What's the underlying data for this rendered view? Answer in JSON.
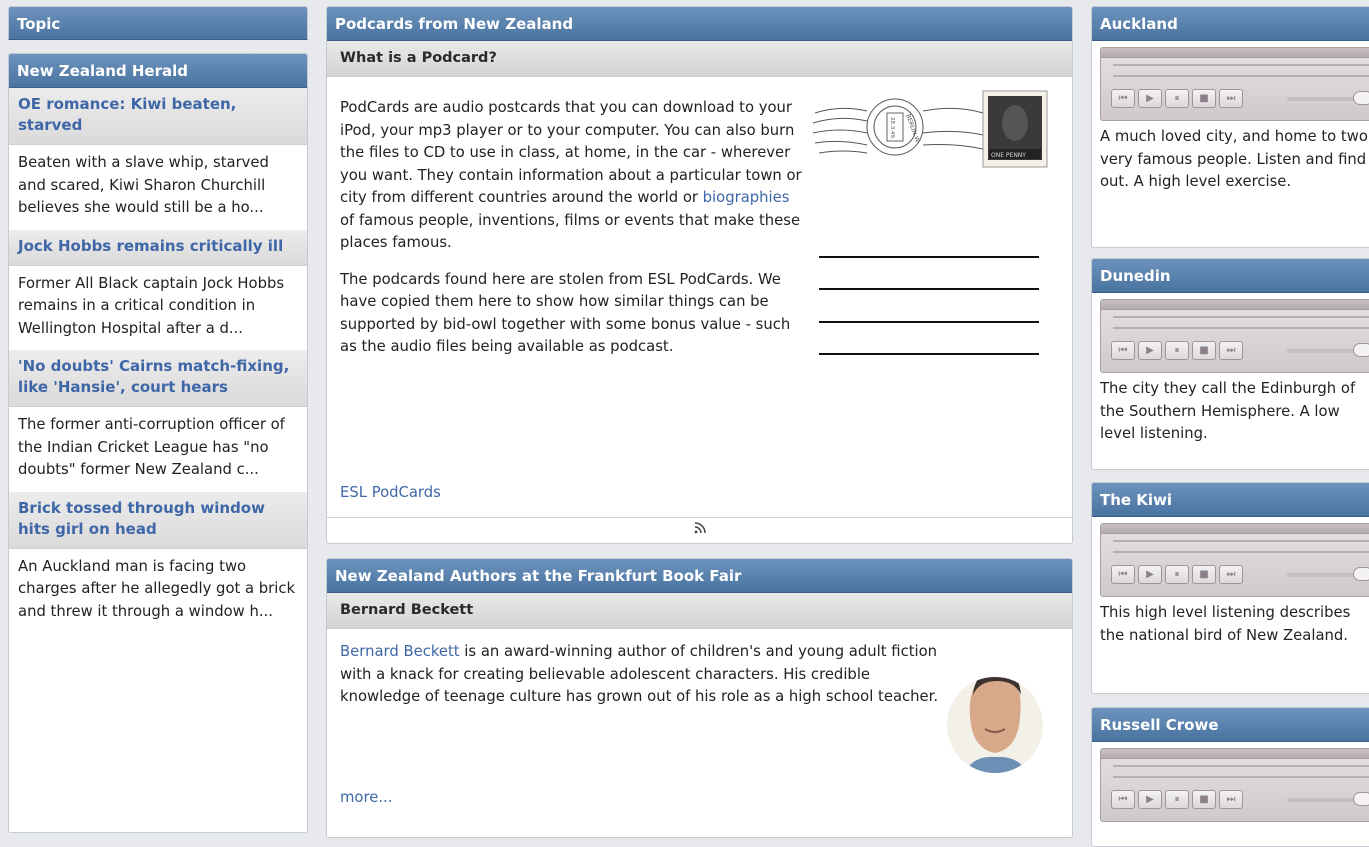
{
  "topic_header": "Topic",
  "news": {
    "title": "New Zealand Herald",
    "items": [
      {
        "title": "OE romance: Kiwi beaten, starved",
        "text": "Beaten with a slave whip, starved and scared, Kiwi Sharon Churchill believes she would still be a ho..."
      },
      {
        "title": "Jock Hobbs remains critically ill",
        "text": "Former All Black captain Jock Hobbs remains in a critical condition in Wellington Hospital after a d..."
      },
      {
        "title": "'No doubts' Cairns match-fixing, like 'Hansie', court hears",
        "text": "The former anti-corruption officer of the Indian Cricket League has \"no doubts\" former New Zealand c..."
      },
      {
        "title": "Brick tossed through window hits girl on head",
        "text": "An Auckland man is facing two charges after he allegedly got a brick and threw it through a window h..."
      }
    ]
  },
  "podcards": {
    "title": "Podcards from New Zealand",
    "subtitle": "What is a Podcard?",
    "p1_before": "PodCards are audio postcards that you can download to your iPod, your mp3 player or to your computer. You can also burn the files to CD to use in class, at home, in the car - wherever you want. They contain information about a particular town or city from different countries around the world or ",
    "p1_link": "biographies",
    "p1_after": " of famous people, inventions, films or events that make these places famous.",
    "p2": "The podcards found here are stolen from ESL PodCards. We have copied them here to show how similar things can be supported by bid-owl together with some bonus value - such as the audio files being available as podcast.",
    "link": "ESL PodCards",
    "rss_icon": "rss-icon",
    "stamp_texts": {
      "postmark": "BERLIN W",
      "date": "28.3.49.",
      "stamp_value": "ONE PENNY"
    }
  },
  "authors": {
    "title": "New Zealand Authors at the Frankfurt Book Fair",
    "subtitle": "Bernard Beckett",
    "name_link": "Bernard Beckett",
    "text": " is an award-winning author of children's and young adult fiction with a knack for creating believable adolescent characters. His credible knowledge of teenage culture has grown out of his role as a high school teacher.",
    "more": "more..."
  },
  "cities": [
    {
      "title": "Auckland",
      "text": "A much loved city, and home to two very famous people. Listen and find out. A high level exercise."
    },
    {
      "title": "Dunedin",
      "text": "The city they call the Edinburgh of the Southern Hemisphere. A low level listening."
    },
    {
      "title": "The Kiwi",
      "text": "This high level listening describes the national bird of New Zealand."
    },
    {
      "title": "Russell Crowe",
      "text": ""
    }
  ],
  "player_buttons": [
    "skip-back-icon",
    "play-icon",
    "pause-icon",
    "stop-icon",
    "skip-forward-icon"
  ],
  "colors": {
    "header": "#4f79a8",
    "link": "#3f67a8",
    "subhead": "#dcdcdc"
  }
}
